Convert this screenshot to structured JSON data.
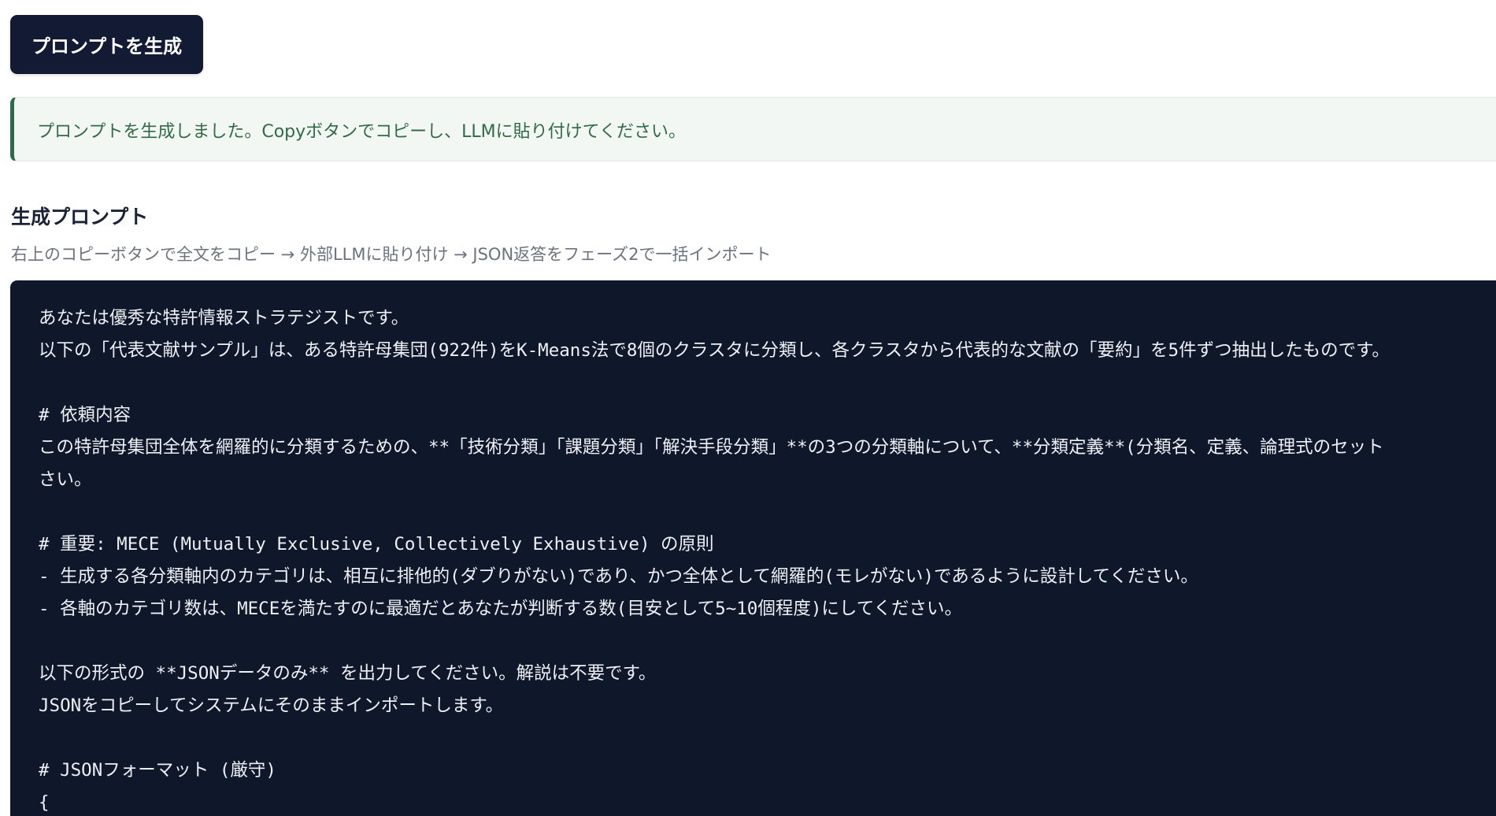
{
  "generate_button": {
    "label": "プロンプトを生成"
  },
  "notice": {
    "text": "プロンプトを生成しました。Copyボタンでコピーし、LLMに貼り付けてください。"
  },
  "section": {
    "title": "生成プロンプト",
    "subtitle": "右上のコピーボタンで全文をコピー → 外部LLMに貼り付け → JSON返答をフェーズ2で一括インポート"
  },
  "prompt": {
    "lines": [
      "あなたは優秀な特許情報ストラテジストです。",
      "以下の「代表文献サンプル」は、ある特許母集団(922件)をK-Means法で8個のクラスタに分類し、各クラスタから代表的な文献の「要約」を5件ずつ抽出したものです。",
      "",
      "# 依頼内容",
      "この特許母集団全体を網羅的に分類するための、**「技術分類」「課題分類」「解決手段分類」**の3つの分類軸について、**分類定義**(分類名、定義、論理式のセット",
      "さい。",
      "",
      "# 重要: MECE (Mutually Exclusive, Collectively Exhaustive) の原則",
      "- 生成する各分類軸内のカテゴリは、相互に排他的(ダブりがない)であり、かつ全体として網羅的(モレがない)であるように設計してください。",
      "- 各軸のカテゴリ数は、MECEを満たすのに最適だとあなたが判断する数(目安として5~10個程度)にしてください。",
      "",
      "以下の形式の **JSONデータのみ** を出力してください。解説は不要です。",
      "JSONをコピーしてシステムにそのままインポートします。",
      "",
      "# JSONフォーマット (厳守)",
      "{"
    ]
  },
  "colors": {
    "button_bg": "#131b34",
    "notice_accent": "#2f6b46",
    "notice_bg": "#f3f7f4",
    "code_bg": "#0f172a",
    "code_text": "#eef0f4"
  }
}
